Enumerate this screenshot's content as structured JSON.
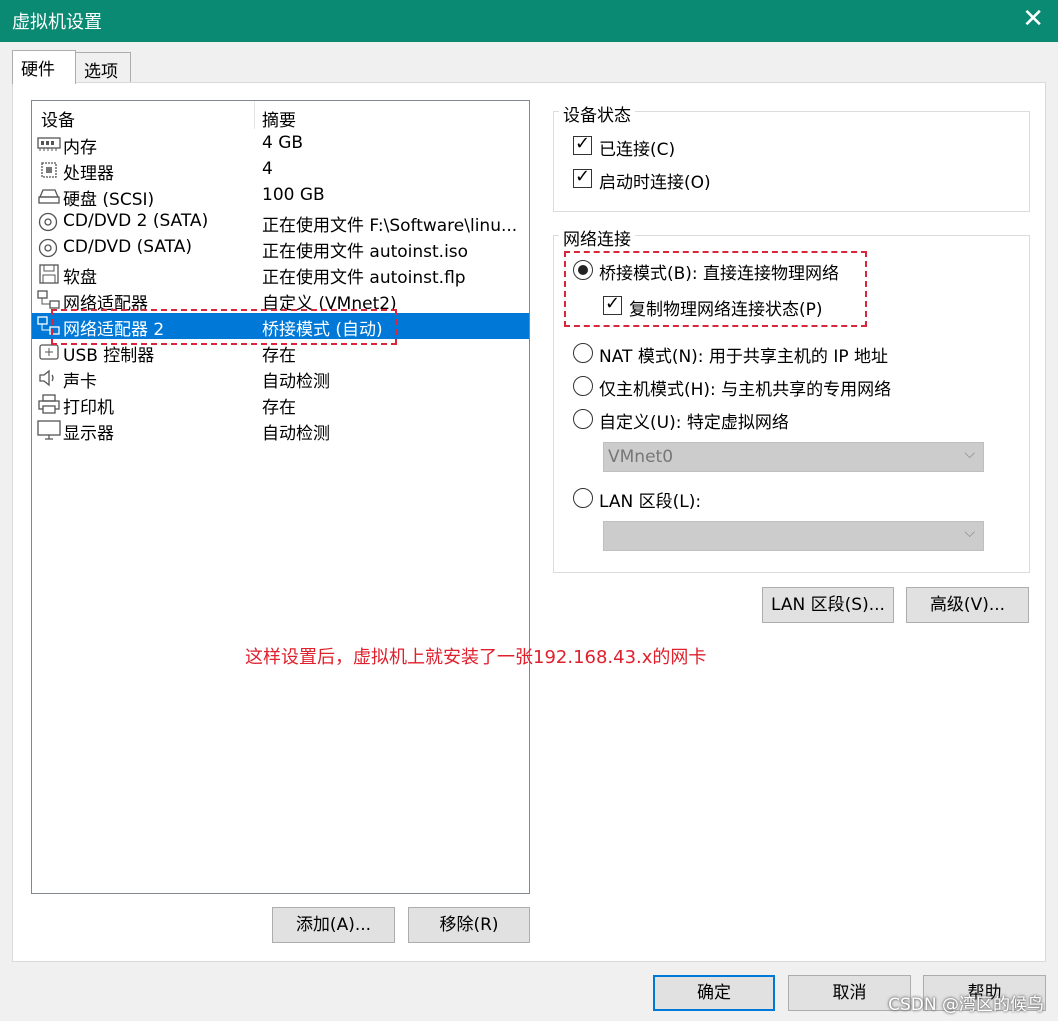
{
  "window": {
    "title": "虚拟机设置",
    "close_glyph": "✕"
  },
  "tabs": [
    {
      "label": "硬件",
      "active": true
    },
    {
      "label": "选项",
      "active": false
    }
  ],
  "device_list": {
    "headers": {
      "device": "设备",
      "summary": "摘要"
    },
    "rows": [
      {
        "icon": "memory-icon",
        "name": "内存",
        "summary": "4 GB"
      },
      {
        "icon": "processor-icon",
        "name": "处理器",
        "summary": "4"
      },
      {
        "icon": "hard-disk-icon",
        "name": "硬盘 (SCSI)",
        "summary": "100 GB"
      },
      {
        "icon": "cd-dvd-icon",
        "name": "CD/DVD 2 (SATA)",
        "summary": "正在使用文件 F:\\Software\\linu..."
      },
      {
        "icon": "cd-dvd-icon",
        "name": "CD/DVD (SATA)",
        "summary": "正在使用文件 autoinst.iso"
      },
      {
        "icon": "floppy-icon",
        "name": "软盘",
        "summary": "正在使用文件 autoinst.flp"
      },
      {
        "icon": "network-adapter-icon",
        "name": "网络适配器",
        "summary": "自定义 (VMnet2)"
      },
      {
        "icon": "network-adapter-icon",
        "name": "网络适配器 2",
        "summary": "桥接模式 (自动)",
        "selected": true
      },
      {
        "icon": "usb-icon",
        "name": "USB 控制器",
        "summary": "存在"
      },
      {
        "icon": "speaker-icon",
        "name": "声卡",
        "summary": "自动检测"
      },
      {
        "icon": "printer-icon",
        "name": "打印机",
        "summary": "存在"
      },
      {
        "icon": "monitor-icon",
        "name": "显示器",
        "summary": "自动检测"
      }
    ]
  },
  "buttons": {
    "add": "添加(A)...",
    "remove": "移除(R)",
    "lan_segments": "LAN 区段(S)...",
    "advanced": "高级(V)...",
    "ok": "确定",
    "cancel": "取消",
    "help": "帮助"
  },
  "device_status": {
    "title": "设备状态",
    "connected": {
      "label": "已连接(C)",
      "checked": true
    },
    "connect_at_power_on": {
      "label": "启动时连接(O)",
      "checked": true
    }
  },
  "network_connection": {
    "title": "网络连接",
    "bridged": {
      "label": "桥接模式(B): 直接连接物理网络",
      "selected": true
    },
    "replicate": {
      "label": "复制物理网络连接状态(P)",
      "checked": true
    },
    "nat": {
      "label": "NAT 模式(N): 用于共享主机的 IP 地址",
      "selected": false
    },
    "host_only": {
      "label": "仅主机模式(H): 与主机共享的专用网络",
      "selected": false
    },
    "custom": {
      "label": "自定义(U): 特定虚拟网络",
      "selected": false
    },
    "custom_select_value": "VMnet0",
    "lan_segment": {
      "label": "LAN 区段(L):",
      "selected": false
    },
    "lan_select_value": ""
  },
  "annotation": "这样设置后，虚拟机上就安装了一张192.168.43.x的网卡",
  "watermark": "CSDN @湾区的候鸟",
  "colors": {
    "titlebar": "#0a8a73",
    "selection": "#0078d7",
    "annotation": "#e0202d"
  }
}
